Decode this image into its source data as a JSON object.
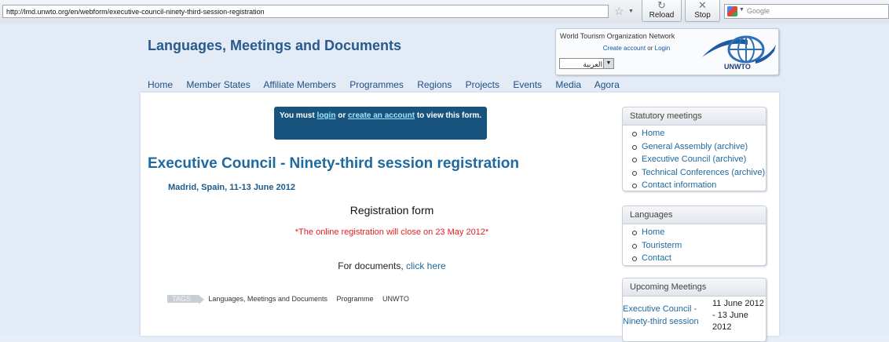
{
  "browser": {
    "url": "http://lmd.unwto.org/en/webform/executive-council-ninety-third-session-registration",
    "reload_label": "Reload",
    "stop_label": "Stop",
    "search_placeholder": "Google"
  },
  "header": {
    "site_title": "Languages, Meetings and Documents",
    "network_title": "World Tourism Organization Network",
    "create_account": "Create account",
    "or": "or",
    "login": "Login",
    "language_selected": "العربية",
    "logo_text": "UNWTO"
  },
  "nav": {
    "items": [
      "Home",
      "Member States",
      "Affiliate Members",
      "Programmes",
      "Regions",
      "Projects",
      "Events",
      "Media",
      "Agora"
    ]
  },
  "main": {
    "notice_prefix": "You must",
    "notice_login": "login",
    "notice_or": "or",
    "notice_create": "create an account",
    "notice_suffix": "to view this form.",
    "title": "Executive Council - Ninety-third session registration",
    "subtitle": "Madrid, Spain, 11-13 June 2012",
    "form_title": "Registration form",
    "close_note": "*The online registration will close on 23 May 2012*",
    "docs_prefix": "For documents,",
    "docs_link": "click here",
    "tags_label": "TAGS",
    "tags": [
      "Languages, Meetings and Documents",
      "Programme",
      "UNWTO"
    ]
  },
  "sidebar": {
    "statutory": {
      "title": "Statutory meetings",
      "items": [
        "Home",
        "General Assembly (archive)",
        "Executive Council (archive)",
        "Technical Conferences (archive)",
        "Contact information"
      ]
    },
    "languages": {
      "title": "Languages",
      "items": [
        "Home",
        "Touristerm",
        "Contact"
      ]
    },
    "upcoming": {
      "title": "Upcoming Meetings",
      "meeting_name": "Executive Council - Ninety-third session",
      "meeting_date": "11 June 2012 - 13 June 2012"
    }
  }
}
